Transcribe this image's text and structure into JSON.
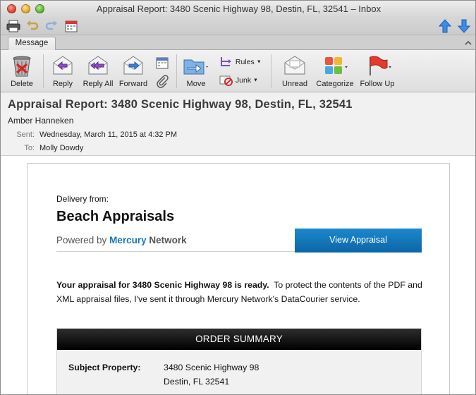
{
  "window": {
    "title": "Appraisal Report: 3480 Scenic Highway 98, Destin, FL, 32541 – Inbox"
  },
  "ribbon": {
    "tab_label": "Message",
    "buttons": {
      "delete": "Delete",
      "reply": "Reply",
      "reply_all": "Reply All",
      "forward": "Forward",
      "move": "Move",
      "rules": "Rules",
      "junk": "Junk",
      "unread": "Unread",
      "categorize": "Categorize",
      "follow_up": "Follow Up"
    }
  },
  "message": {
    "subject": "Appraisal Report: 3480 Scenic Highway 98, Destin, FL, 32541",
    "from": "Amber Hanneken",
    "sent_label": "Sent:",
    "sent_value": "Wednesday, March 11, 2015 at 4:32 PM",
    "to_label": "To:",
    "to_value": "Molly Dowdy"
  },
  "email": {
    "delivery_from": "Delivery from:",
    "company": "Beach Appraisals",
    "powered_by": "Powered by",
    "powered_brand": "Mercury",
    "powered_network": "Network",
    "view_button": "View Appraisal",
    "ready_bold": "Your appraisal for 3480 Scenic Highway 98 is ready.",
    "ready_rest": "To protect the contents of the PDF and XML appraisal files, I've sent it through Mercury Network's DataCourier service.",
    "summary_title": "ORDER SUMMARY",
    "subject_property_label": "Subject Property:",
    "subject_property_line1": "3480 Scenic Highway 98",
    "subject_property_line2": "Destin, FL 32541"
  },
  "colors": {
    "brand_blue": "#1a76bd",
    "button_blue": "#0b66a8",
    "summary_header": "#000000"
  },
  "icons": [
    "print-icon",
    "undo-icon",
    "redo-icon",
    "calendar-icon",
    "arrow-up-icon",
    "arrow-down-icon",
    "trash-icon",
    "reply-icon",
    "reply-all-icon",
    "forward-icon",
    "meeting-icon",
    "attachment-icon",
    "folder-move-icon",
    "rules-icon",
    "junk-icon",
    "envelope-unread-icon",
    "categorize-icon",
    "flag-icon"
  ]
}
